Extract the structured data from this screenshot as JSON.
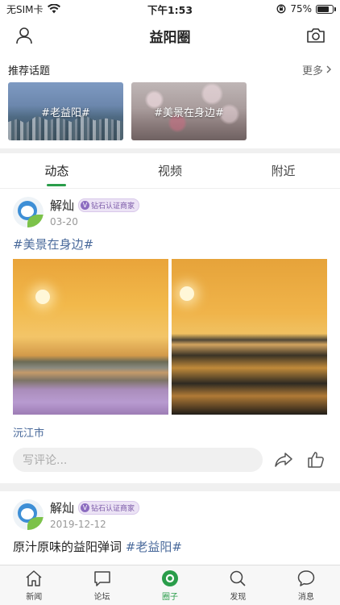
{
  "status_bar": {
    "carrier": "无SIM卡",
    "time": "下午1:53",
    "battery_text": "75%",
    "battery_level": 0.75
  },
  "header": {
    "title": "益阳圈"
  },
  "topics": {
    "title": "推荐话题",
    "more": "更多",
    "items": [
      {
        "label": "#老益阳#"
      },
      {
        "label": "#美景在身边#"
      }
    ]
  },
  "tabs": [
    {
      "label": "动态",
      "active": true
    },
    {
      "label": "视频",
      "active": false
    },
    {
      "label": "附近",
      "active": false
    }
  ],
  "posts": [
    {
      "author": "解灿",
      "badge": "钻石认证商家",
      "date": "03-20",
      "topic": "#美景在身边#",
      "location": "沅江市",
      "comment_placeholder": "写评论..."
    },
    {
      "author": "解灿",
      "badge": "钻石认证商家",
      "date": "2019-12-12",
      "text": "原汁原味的益阳弹词",
      "topic": "#老益阳#"
    }
  ],
  "bottom_nav": [
    {
      "label": "新闻",
      "icon": "home-icon",
      "active": false
    },
    {
      "label": "论坛",
      "icon": "chat-bubble-icon",
      "active": false
    },
    {
      "label": "圈子",
      "icon": "circle-icon",
      "active": true
    },
    {
      "label": "发现",
      "icon": "search-icon",
      "active": false
    },
    {
      "label": "消息",
      "icon": "message-icon",
      "active": false
    }
  ],
  "colors": {
    "accent": "#2a9d4a",
    "topic_link": "#4a6a9b",
    "badge": "#8c6cc0"
  }
}
